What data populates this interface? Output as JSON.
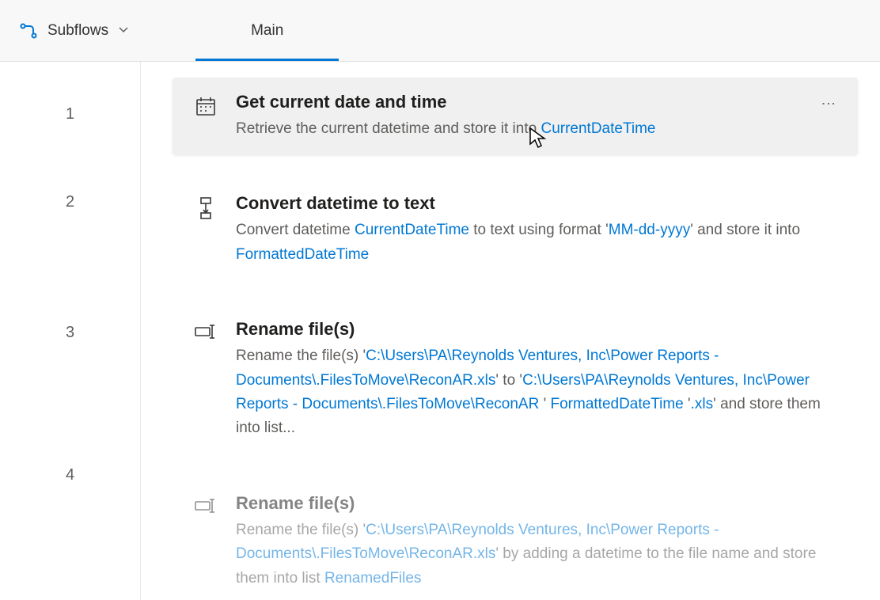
{
  "header": {
    "subflows_label": "Subflows"
  },
  "tabs": [
    {
      "label": "Main",
      "active": true
    }
  ],
  "steps": [
    {
      "line": "1",
      "title": "Get current date and time",
      "icon": "calendar-icon",
      "selected": true,
      "desc_parts": [
        {
          "text": "Retrieve the current datetime and store it into "
        },
        {
          "text": "CurrentDateTime",
          "kind": "variable"
        }
      ]
    },
    {
      "line": "2",
      "title": "Convert datetime to text",
      "icon": "convert-icon",
      "desc_parts": [
        {
          "text": "Convert datetime "
        },
        {
          "text": "CurrentDateTime",
          "kind": "variable"
        },
        {
          "text": " to text using format '"
        },
        {
          "text": "MM-dd-yyyy",
          "kind": "literal"
        },
        {
          "text": "' and store it into "
        },
        {
          "text": "FormattedDateTime",
          "kind": "variable"
        }
      ]
    },
    {
      "line": "3",
      "title": "Rename file(s)",
      "icon": "rename-icon",
      "desc_parts": [
        {
          "text": "Rename the file(s) '"
        },
        {
          "text": "C:\\Users\\PA\\Reynolds Ventures, Inc\\Power Reports - Documents\\.FilesToMove\\ReconAR.xls",
          "kind": "literal"
        },
        {
          "text": "' to '"
        },
        {
          "text": "C:\\Users\\PA\\Reynolds Ventures, Inc\\Power Reports - Documents\\.FilesToMove\\ReconAR ",
          "kind": "literal"
        },
        {
          "text": "' "
        },
        {
          "text": "FormattedDateTime",
          "kind": "variable"
        },
        {
          "text": " '"
        },
        {
          "text": ".xls",
          "kind": "literal"
        },
        {
          "text": "' and store them into list..."
        }
      ]
    },
    {
      "line": "4",
      "title": "Rename file(s)",
      "icon": "rename-icon",
      "faded": true,
      "desc_parts": [
        {
          "text": "Rename the file(s) '"
        },
        {
          "text": "C:\\Users\\PA\\Reynolds Ventures, Inc\\Power Reports - Documents\\.FilesToMove\\ReconAR.xls",
          "kind": "literal"
        },
        {
          "text": "' by adding a datetime to the file name and store them into list "
        },
        {
          "text": "RenamedFiles",
          "kind": "variable"
        }
      ]
    }
  ]
}
